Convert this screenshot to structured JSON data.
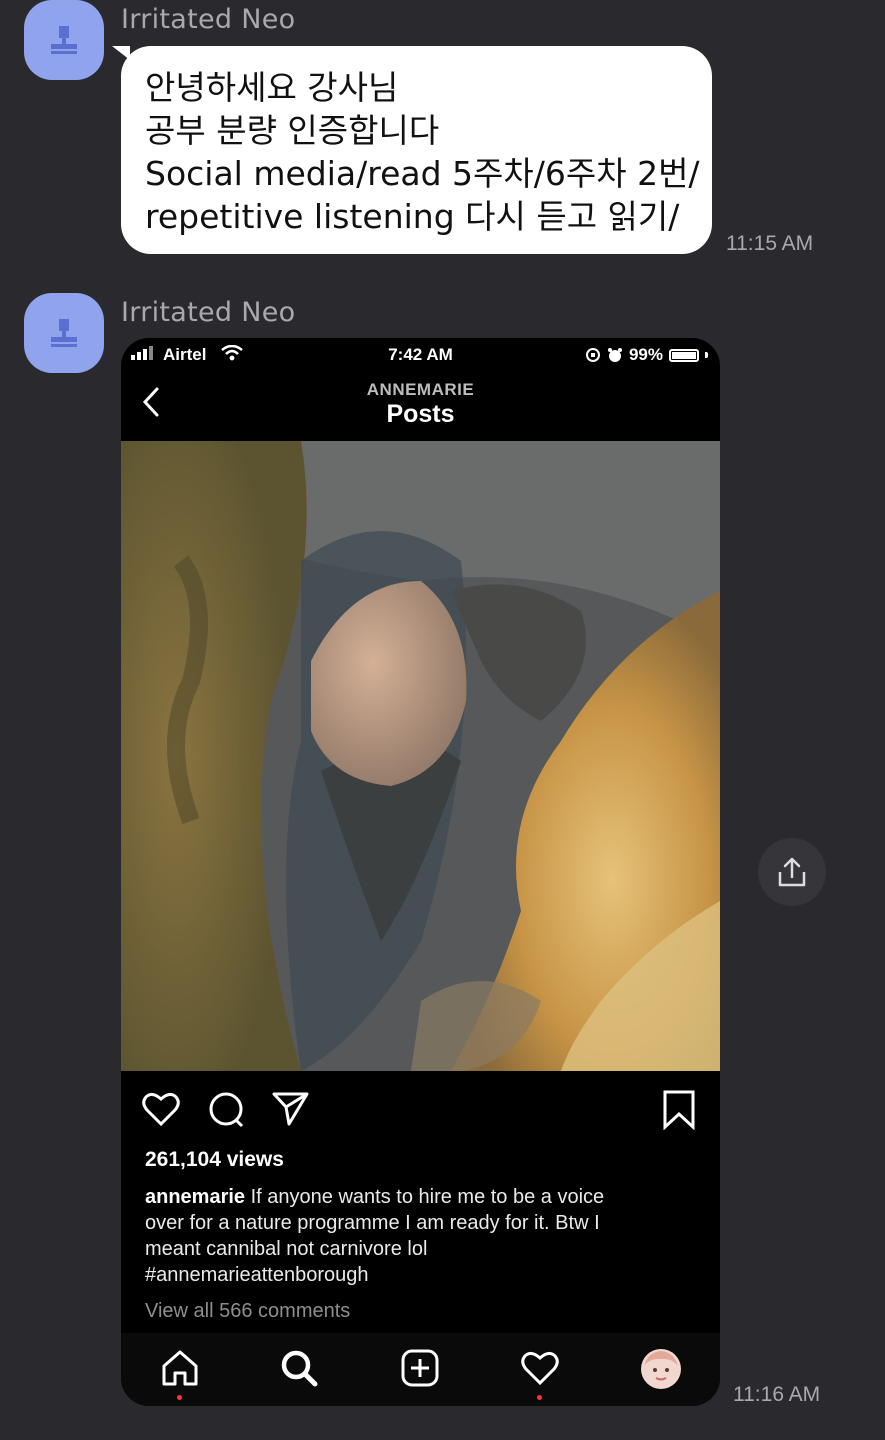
{
  "messages": [
    {
      "sender": "Irritated Neo",
      "type": "text",
      "lines": [
        "안녕하세요 강사님",
        "공부 분량 인증합니다",
        "Social media/read 5주차/6주차 2번/",
        "repetitive listening 다시 듣고 읽기/"
      ],
      "time": "11:15 AM"
    },
    {
      "sender": "Irritated Neo",
      "type": "image",
      "time": "11:16 AM"
    }
  ],
  "screenshot": {
    "status_bar": {
      "carrier": "Airtel",
      "time": "7:42 AM",
      "battery": "99%"
    },
    "nav": {
      "username": "ANNEMARIE",
      "title": "Posts"
    },
    "post": {
      "views": "261,104 views",
      "caption_user": "annemarie",
      "caption_lines": [
        " If anyone wants to hire me to be a voice",
        "over for a nature programme I am ready for it. Btw I",
        "meant cannibal not carnivore lol",
        "#annemarieattenborough"
      ],
      "view_comments": "View all 566 comments"
    },
    "tabs": [
      "home-icon",
      "search-icon",
      "add-post-icon",
      "activity-heart-icon",
      "profile-avatar"
    ]
  },
  "colors": {
    "background": "#2a2a2e",
    "avatar": "#8fa4ec",
    "bubble": "#ffffff",
    "notification_dot": "#ff3040"
  }
}
